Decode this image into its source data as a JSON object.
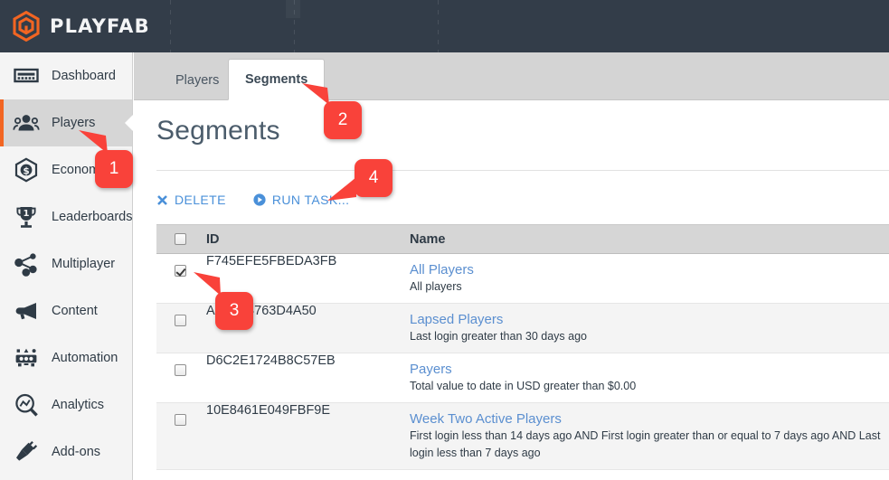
{
  "brand": {
    "name": "PLAYFAB",
    "logo_icon": "playfab-hex-logo-icon"
  },
  "colors": {
    "header_bg": "#333d49",
    "sidebar_bg": "#f4f4f4",
    "active_item_bg": "#d6d6d6",
    "accent_orange": "#f26522",
    "link_blue": "#5b8fd0",
    "action_blue": "#4a90d9",
    "callout_red": "#f9423a",
    "tabstrip_bg": "#d4d4d4",
    "table_header_bg": "#d6d6d6",
    "row_alt_bg": "#f4f4f4"
  },
  "sidebar": {
    "items": [
      {
        "label": "Dashboard",
        "icon": "dashboard-icon",
        "active": false
      },
      {
        "label": "Players",
        "icon": "players-icon",
        "active": true
      },
      {
        "label": "Economy",
        "icon": "economy-icon",
        "active": false
      },
      {
        "label": "Leaderboards",
        "icon": "leaderboards-icon",
        "active": false
      },
      {
        "label": "Multiplayer",
        "icon": "multiplayer-icon",
        "active": false
      },
      {
        "label": "Content",
        "icon": "content-icon",
        "active": false
      },
      {
        "label": "Automation",
        "icon": "automation-icon",
        "active": false
      },
      {
        "label": "Analytics",
        "icon": "analytics-icon",
        "active": false
      },
      {
        "label": "Add-ons",
        "icon": "addons-icon",
        "active": false
      }
    ]
  },
  "tabs": [
    {
      "label": "Players",
      "active": false
    },
    {
      "label": "Segments",
      "active": true
    }
  ],
  "page": {
    "title": "Segments"
  },
  "toolbar": {
    "delete": {
      "label": "DELETE",
      "icon": "x-cross-icon"
    },
    "run_task": {
      "label": "RUN TASK...",
      "icon": "play-circle-icon"
    }
  },
  "table": {
    "columns": [
      "",
      "ID",
      "Name"
    ],
    "header_checkbox_checked": false,
    "rows": [
      {
        "checked": true,
        "id": "F745EFE5FBEDA3FB",
        "name": "All Players",
        "description": "All players"
      },
      {
        "checked": false,
        "id": "A…CFB763D4A50",
        "name": "Lapsed Players",
        "description": "Last login greater than 30 days ago"
      },
      {
        "checked": false,
        "id": "D6C2E1724B8C57EB",
        "name": "Payers",
        "description": "Total value to date in USD greater than $0.00"
      },
      {
        "checked": false,
        "id": "10E8461E049FBF9E",
        "name": "Week Two Active Players",
        "description": "First login less than 14 days ago AND First login greater than or equal to 7 days ago AND Last login less than 7 days ago"
      }
    ]
  },
  "callouts": [
    {
      "number": "1",
      "target": "sidebar-item-players"
    },
    {
      "number": "2",
      "target": "tab-segments"
    },
    {
      "number": "3",
      "target": "row-checkbox-all-players"
    },
    {
      "number": "4",
      "target": "run-task-button"
    }
  ]
}
